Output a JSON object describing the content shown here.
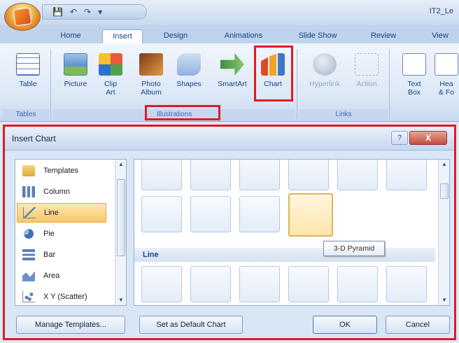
{
  "window": {
    "document_title": "IT2_Le",
    "qat_icons": [
      "save-icon",
      "undo-icon",
      "redo-icon",
      "customize-icon"
    ]
  },
  "tabs": [
    {
      "label": "Home"
    },
    {
      "label": "Insert",
      "active": true
    },
    {
      "label": "Design"
    },
    {
      "label": "Animations"
    },
    {
      "label": "Slide Show"
    },
    {
      "label": "Review"
    },
    {
      "label": "View"
    }
  ],
  "ribbon": {
    "table": {
      "label": "Table",
      "icon": "table-icon"
    },
    "picture": {
      "label": "Picture",
      "icon": "picture-icon"
    },
    "clip_art": {
      "label": "Clip\nArt",
      "icon": "clip-art-icon"
    },
    "photo_album": {
      "label": "Photo\nAlbum",
      "icon": "photo-album-icon"
    },
    "shapes": {
      "label": "Shapes",
      "icon": "shapes-icon"
    },
    "smartart": {
      "label": "SmartArt",
      "icon": "smartart-icon"
    },
    "chart": {
      "label": "Chart",
      "icon": "chart-icon"
    },
    "hyperlink": {
      "label": "Hyperlink",
      "icon": "hyperlink-icon"
    },
    "action": {
      "label": "Action",
      "icon": "action-icon"
    },
    "text_box": {
      "label": "Text\nBox",
      "icon": "text-box-icon"
    },
    "header_footer": {
      "label": "Hea\n& Fo",
      "icon": "header-footer-icon"
    },
    "groups": {
      "tables": "Tables",
      "illustrations": "Illustrations",
      "links": "Links"
    }
  },
  "dialog": {
    "title": "Insert Chart",
    "help_label": "?",
    "close_label": "X",
    "categories": [
      {
        "label": "Templates",
        "icon": "folder-icon"
      },
      {
        "label": "Column",
        "icon": "column-chart-icon"
      },
      {
        "label": "Line",
        "icon": "line-chart-icon",
        "selected": true
      },
      {
        "label": "Pie",
        "icon": "pie-chart-icon"
      },
      {
        "label": "Bar",
        "icon": "bar-chart-icon"
      },
      {
        "label": "Area",
        "icon": "area-chart-icon"
      },
      {
        "label": "X Y (Scatter)",
        "icon": "scatter-chart-icon"
      }
    ],
    "section_line": "Line",
    "tooltip": "3-D Pyramid",
    "buttons": {
      "manage_templates": "Manage Templates...",
      "set_default": "Set as Default Chart",
      "ok": "OK",
      "cancel": "Cancel"
    }
  },
  "colors": {
    "highlight": "#e01b23",
    "ribbon_text": "#15428b",
    "selection": "#f9c86a"
  }
}
